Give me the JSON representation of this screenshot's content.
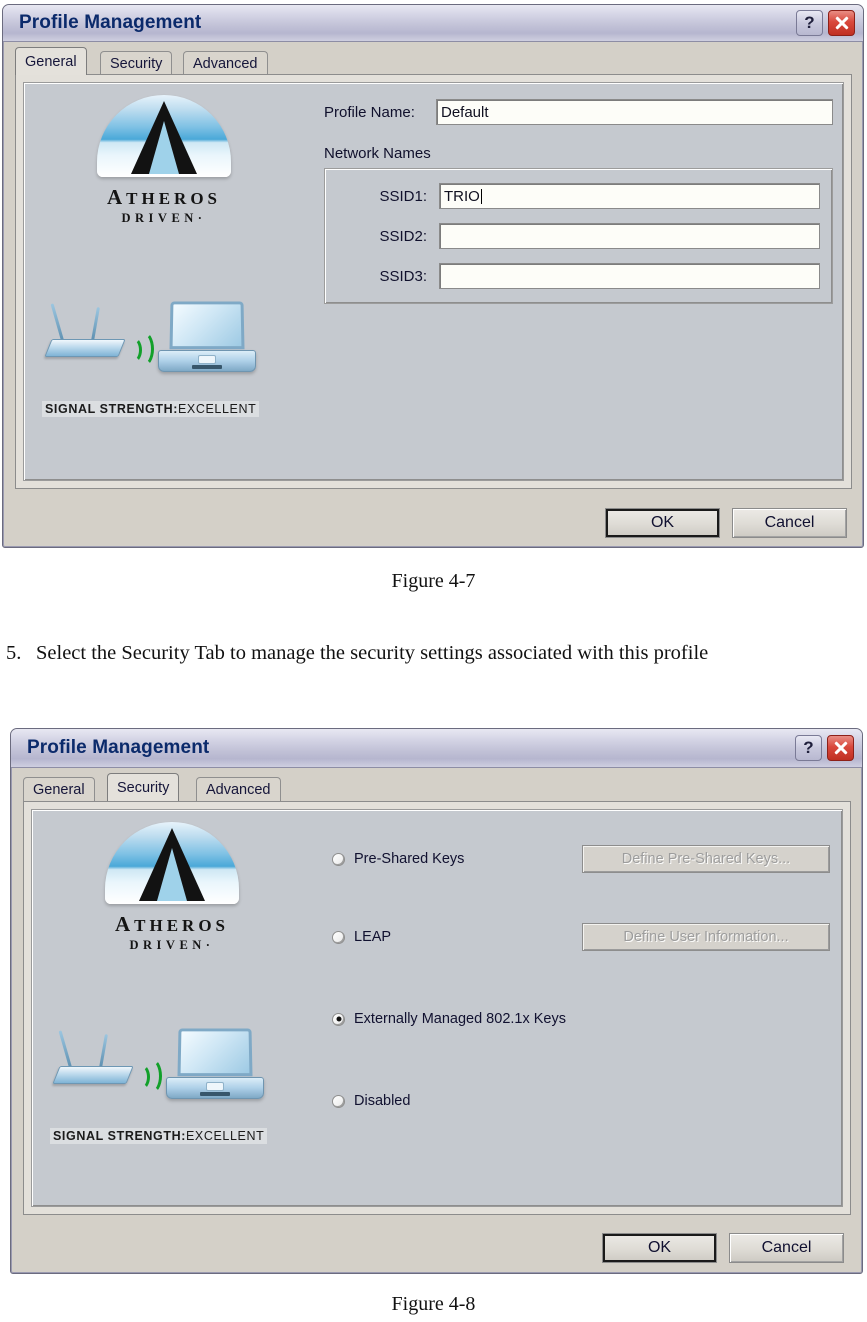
{
  "document": {
    "figure_1_caption": "Figure 4-7",
    "figure_2_caption": "Figure 4-8",
    "step": {
      "number": "5.",
      "text": "Select the Security Tab to manage the security settings associated with this profile"
    }
  },
  "dialog_general": {
    "title": "Profile Management",
    "titlebar_buttons": {
      "help": "?",
      "close": "✕"
    },
    "tabs": [
      {
        "label": "General",
        "active": true
      },
      {
        "label": "Security",
        "active": false
      },
      {
        "label": "Advanced",
        "active": false
      }
    ],
    "brand": {
      "word": "ATHEROS",
      "word_cap": "A",
      "word_rest": "THEROS",
      "sub": "DRIVEN·"
    },
    "signal": {
      "label": "SIGNAL STRENGTH:",
      "value": "EXCELLENT"
    },
    "fields": {
      "profile_name_label": "Profile Name:",
      "profile_name_value": "Default",
      "group_label": "Network Names",
      "ssid1_label": "SSID1:",
      "ssid1_value": "TRIO",
      "ssid2_label": "SSID2:",
      "ssid2_value": "",
      "ssid3_label": "SSID3:",
      "ssid3_value": ""
    },
    "buttons": {
      "ok": "OK",
      "cancel": "Cancel"
    }
  },
  "dialog_security": {
    "title": "Profile Management",
    "titlebar_buttons": {
      "help": "?",
      "close": "✕"
    },
    "tabs": [
      {
        "label": "General",
        "active": false
      },
      {
        "label": "Security",
        "active": true
      },
      {
        "label": "Advanced",
        "active": false
      }
    ],
    "brand": {
      "word_cap": "A",
      "word_rest": "THEROS",
      "sub": "DRIVEN·"
    },
    "signal": {
      "label": "SIGNAL STRENGTH:",
      "value": "EXCELLENT"
    },
    "options": [
      {
        "label": "Pre-Shared Keys",
        "selected": false,
        "button": "Define Pre-Shared Keys...",
        "button_disabled": true
      },
      {
        "label": "LEAP",
        "selected": false,
        "button": "Define User Information...",
        "button_disabled": true
      },
      {
        "label": "Externally Managed 802.1x Keys",
        "selected": true,
        "button": null
      },
      {
        "label": "Disabled",
        "selected": false,
        "button": null
      }
    ],
    "buttons": {
      "ok": "OK",
      "cancel": "Cancel"
    }
  },
  "colors": {
    "titlebar_text": "#0b2a6b",
    "close_button": "#d9483c",
    "panel_bg": "#c5c9cf",
    "dialog_bg": "#d4d0c8",
    "wave_green": "#12a02a"
  }
}
